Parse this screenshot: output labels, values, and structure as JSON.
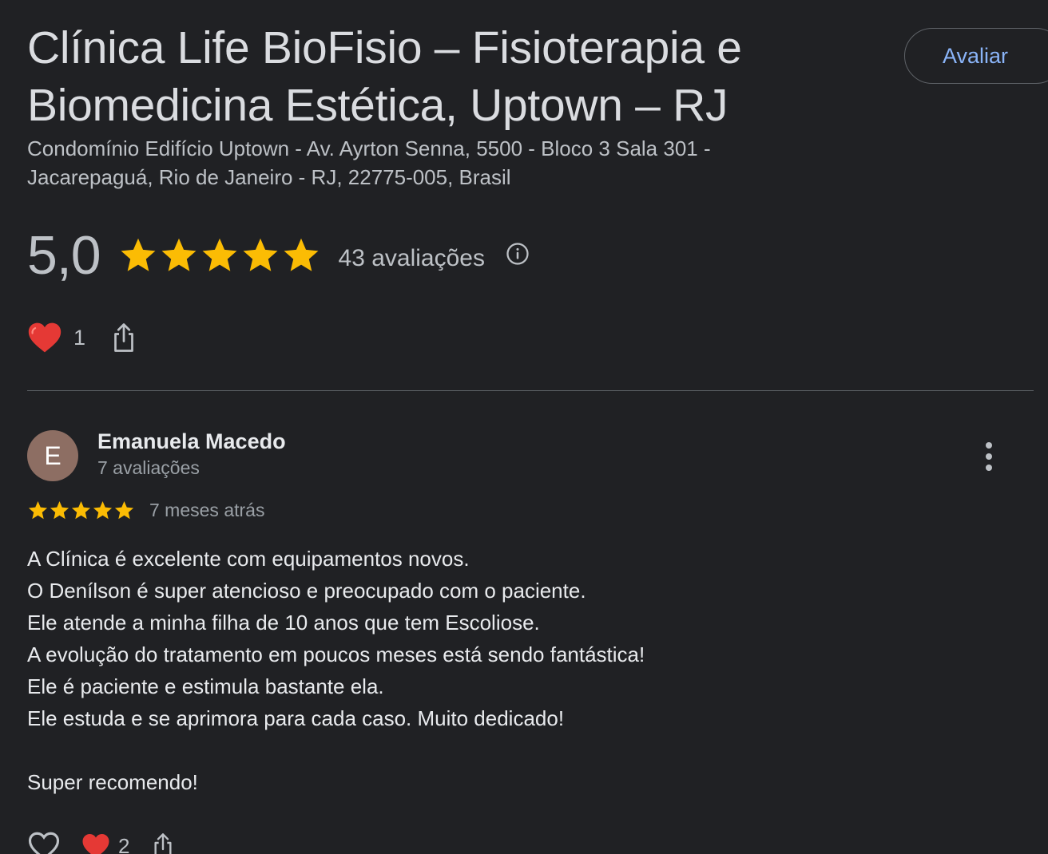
{
  "place": {
    "name": "Clínica Life BioFisio – Fisioterapia e Biomedicina Estética, Uptown – RJ",
    "address": "Condomínio Edifício Uptown - Av. Ayrton Senna, 5500 - Bloco 3 Sala 301 - Jacarepaguá, Rio de Janeiro - RJ, 22775-005, Brasil",
    "rate_button_label": "Avaliar",
    "rating_score": "5,0",
    "rating_stars": 5,
    "review_count_label": "43 avaliações",
    "like_count": "1"
  },
  "review": {
    "author_initial": "E",
    "author_name": "Emanuela Macedo",
    "author_meta": "7 avaliações",
    "stars": 5,
    "time": "7 meses atrás",
    "lines": [
      "A Clínica é excelente com equipamentos novos.",
      "O Denílson é super atencioso e preocupado com o paciente.",
      "Ele atende a minha filha de 10 anos que tem Escoliose.",
      "A evolução do tratamento em poucos meses está sendo fantástica!",
      "Ele é paciente e estimula bastante ela.",
      "Ele estuda e se aprimora para cada caso. Muito dedicado!",
      "",
      "Super recomendo!"
    ],
    "like_count": "2"
  },
  "colors": {
    "background": "#202124",
    "accent": "#8ab4f8",
    "star": "#fbbc04",
    "heart": "#e53935",
    "avatar": "#8d6e63"
  },
  "icons": [
    "star-icon",
    "info-icon",
    "heart-icon",
    "share-icon",
    "more-vert-icon",
    "heart-outline-icon"
  ]
}
